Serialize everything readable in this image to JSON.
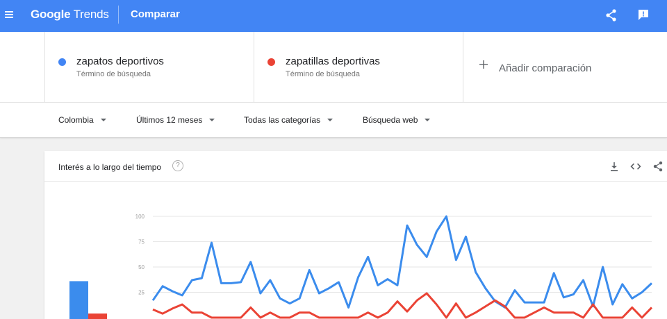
{
  "header": {
    "logo_main": "Google",
    "logo_sub": "Trends",
    "title": "Comparar",
    "icons": [
      "menu-icon",
      "share-icon",
      "feedback-icon"
    ],
    "color": "#4285f4"
  },
  "terms": [
    {
      "name": "zapatos deportivos",
      "subtitle": "Término de búsqueda",
      "color": "#4285f4"
    },
    {
      "name": "zapatillas deportivas",
      "subtitle": "Término de búsqueda",
      "color": "#ea4335"
    }
  ],
  "add_comparison": {
    "label": "Añadir comparación",
    "icon": "plus-icon"
  },
  "filters": {
    "country": "Colombia",
    "period": "Últimos 12 meses",
    "category": "Todas las categorías",
    "search_type": "Búsqueda web"
  },
  "card": {
    "title": "Interés a lo largo del tiempo",
    "help": "?",
    "tools": [
      "download-icon",
      "embed-icon",
      "share-icon"
    ]
  },
  "chart_data": {
    "type": "line",
    "ylim": [
      0,
      100
    ],
    "yticks": [
      "100",
      "75",
      "50",
      "25"
    ],
    "grid": true,
    "averages": [
      {
        "term": "zapatos deportivos",
        "value": 36,
        "color": "#4285f4"
      },
      {
        "term": "zapatillas deportivas",
        "value": 4,
        "color": "#ea4335"
      }
    ],
    "series": [
      {
        "name": "zapatos deportivos",
        "color": "#4285f4",
        "values": [
          17,
          31,
          26,
          22,
          37,
          39,
          74,
          34,
          34,
          35,
          55,
          24,
          37,
          19,
          14,
          19,
          47,
          24,
          29,
          35,
          10,
          40,
          60,
          32,
          38,
          32,
          91,
          72,
          60,
          85,
          100,
          57,
          80,
          45,
          29,
          16,
          10,
          27,
          15,
          15,
          15,
          44,
          20,
          23,
          37,
          11,
          50,
          13,
          33,
          19,
          25,
          34
        ]
      },
      {
        "name": "zapatillas deportivas",
        "color": "#ea4335",
        "values": [
          8,
          4,
          9,
          13,
          5,
          5,
          0,
          0,
          0,
          0,
          10,
          0,
          5,
          0,
          0,
          5,
          5,
          0,
          0,
          0,
          0,
          0,
          5,
          0,
          5,
          16,
          6,
          17,
          24,
          13,
          0,
          14,
          0,
          5,
          11,
          17,
          11,
          0,
          0,
          5,
          10,
          5,
          5,
          5,
          0,
          13,
          0,
          0,
          0,
          10,
          0,
          10
        ]
      }
    ]
  }
}
